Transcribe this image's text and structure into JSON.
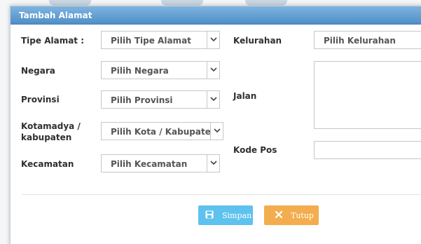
{
  "dialog": {
    "title": "Tambah Alamat"
  },
  "form": {
    "tipe_alamat": {
      "label": "Tipe Alamat :",
      "value": "Pilih Tipe Alamat"
    },
    "negara": {
      "label": "Negara",
      "value": "Pilih Negara"
    },
    "provinsi": {
      "label": "Provinsi",
      "value": "Pilih Provinsi"
    },
    "kotamadya": {
      "label_line1": "Kotamadya /",
      "label_line2": "kabupaten",
      "value": "Pilih Kota / Kabupaten"
    },
    "kecamatan": {
      "label": "Kecamatan",
      "value": "Pilih Kecamatan"
    },
    "kelurahan": {
      "label": "Kelurahan",
      "value": "Pilih Kelurahan"
    },
    "jalan": {
      "label": "Jalan",
      "value": ""
    },
    "kode_pos": {
      "label": "Kode Pos",
      "value": ""
    }
  },
  "buttons": {
    "save_label": "Simpan",
    "close_label": "Tutup"
  },
  "colors": {
    "titlebar": "#5b9bd0",
    "save": "#5ec2ee",
    "close": "#f3ad4e"
  },
  "icons": {
    "select_arrow": "chevron-down-icon",
    "save": "floppy-disk-icon",
    "close": "close-x-icon"
  }
}
